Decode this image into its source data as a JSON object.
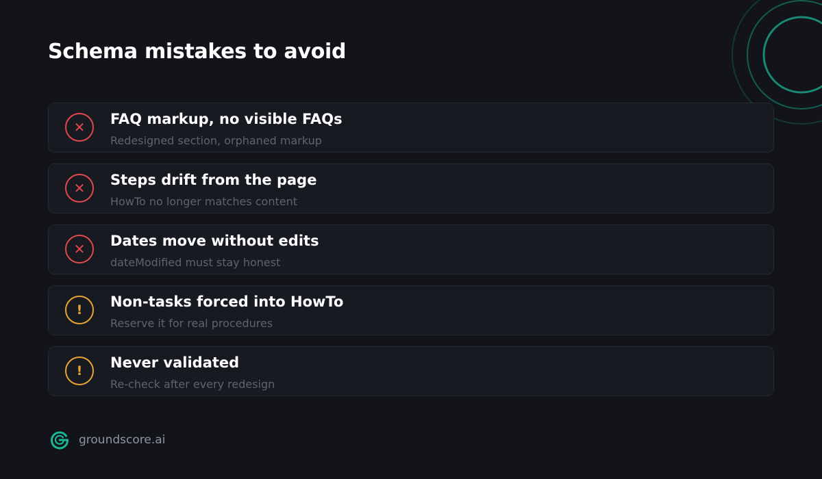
{
  "title": "Schema mistakes to avoid",
  "items": [
    {
      "icon": "x-circle-icon",
      "kind": "error",
      "glyph": "✕",
      "title": "FAQ markup, no visible FAQs",
      "subtitle": "Redesigned section, orphaned markup"
    },
    {
      "icon": "x-circle-icon",
      "kind": "error",
      "glyph": "✕",
      "title": "Steps drift from the page",
      "subtitle": "HowTo no longer matches content"
    },
    {
      "icon": "x-circle-icon",
      "kind": "error",
      "glyph": "✕",
      "title": "Dates move without edits",
      "subtitle": "dateModified must stay honest"
    },
    {
      "icon": "exclamation-circle-icon",
      "kind": "warning",
      "glyph": "!",
      "title": "Non-tasks forced into HowTo",
      "subtitle": "Reserve it for real procedures"
    },
    {
      "icon": "exclamation-circle-icon",
      "kind": "warning",
      "glyph": "!",
      "title": "Never validated",
      "subtitle": "Re-check after every redesign"
    }
  ],
  "brand": {
    "name": "groundscore.ai",
    "logo_icon": "groundscore-logo-icon"
  },
  "colors": {
    "background": "#121419",
    "card": "#171a20",
    "error": "#e0484d",
    "warning": "#e8a530",
    "accent": "#1bb896"
  }
}
